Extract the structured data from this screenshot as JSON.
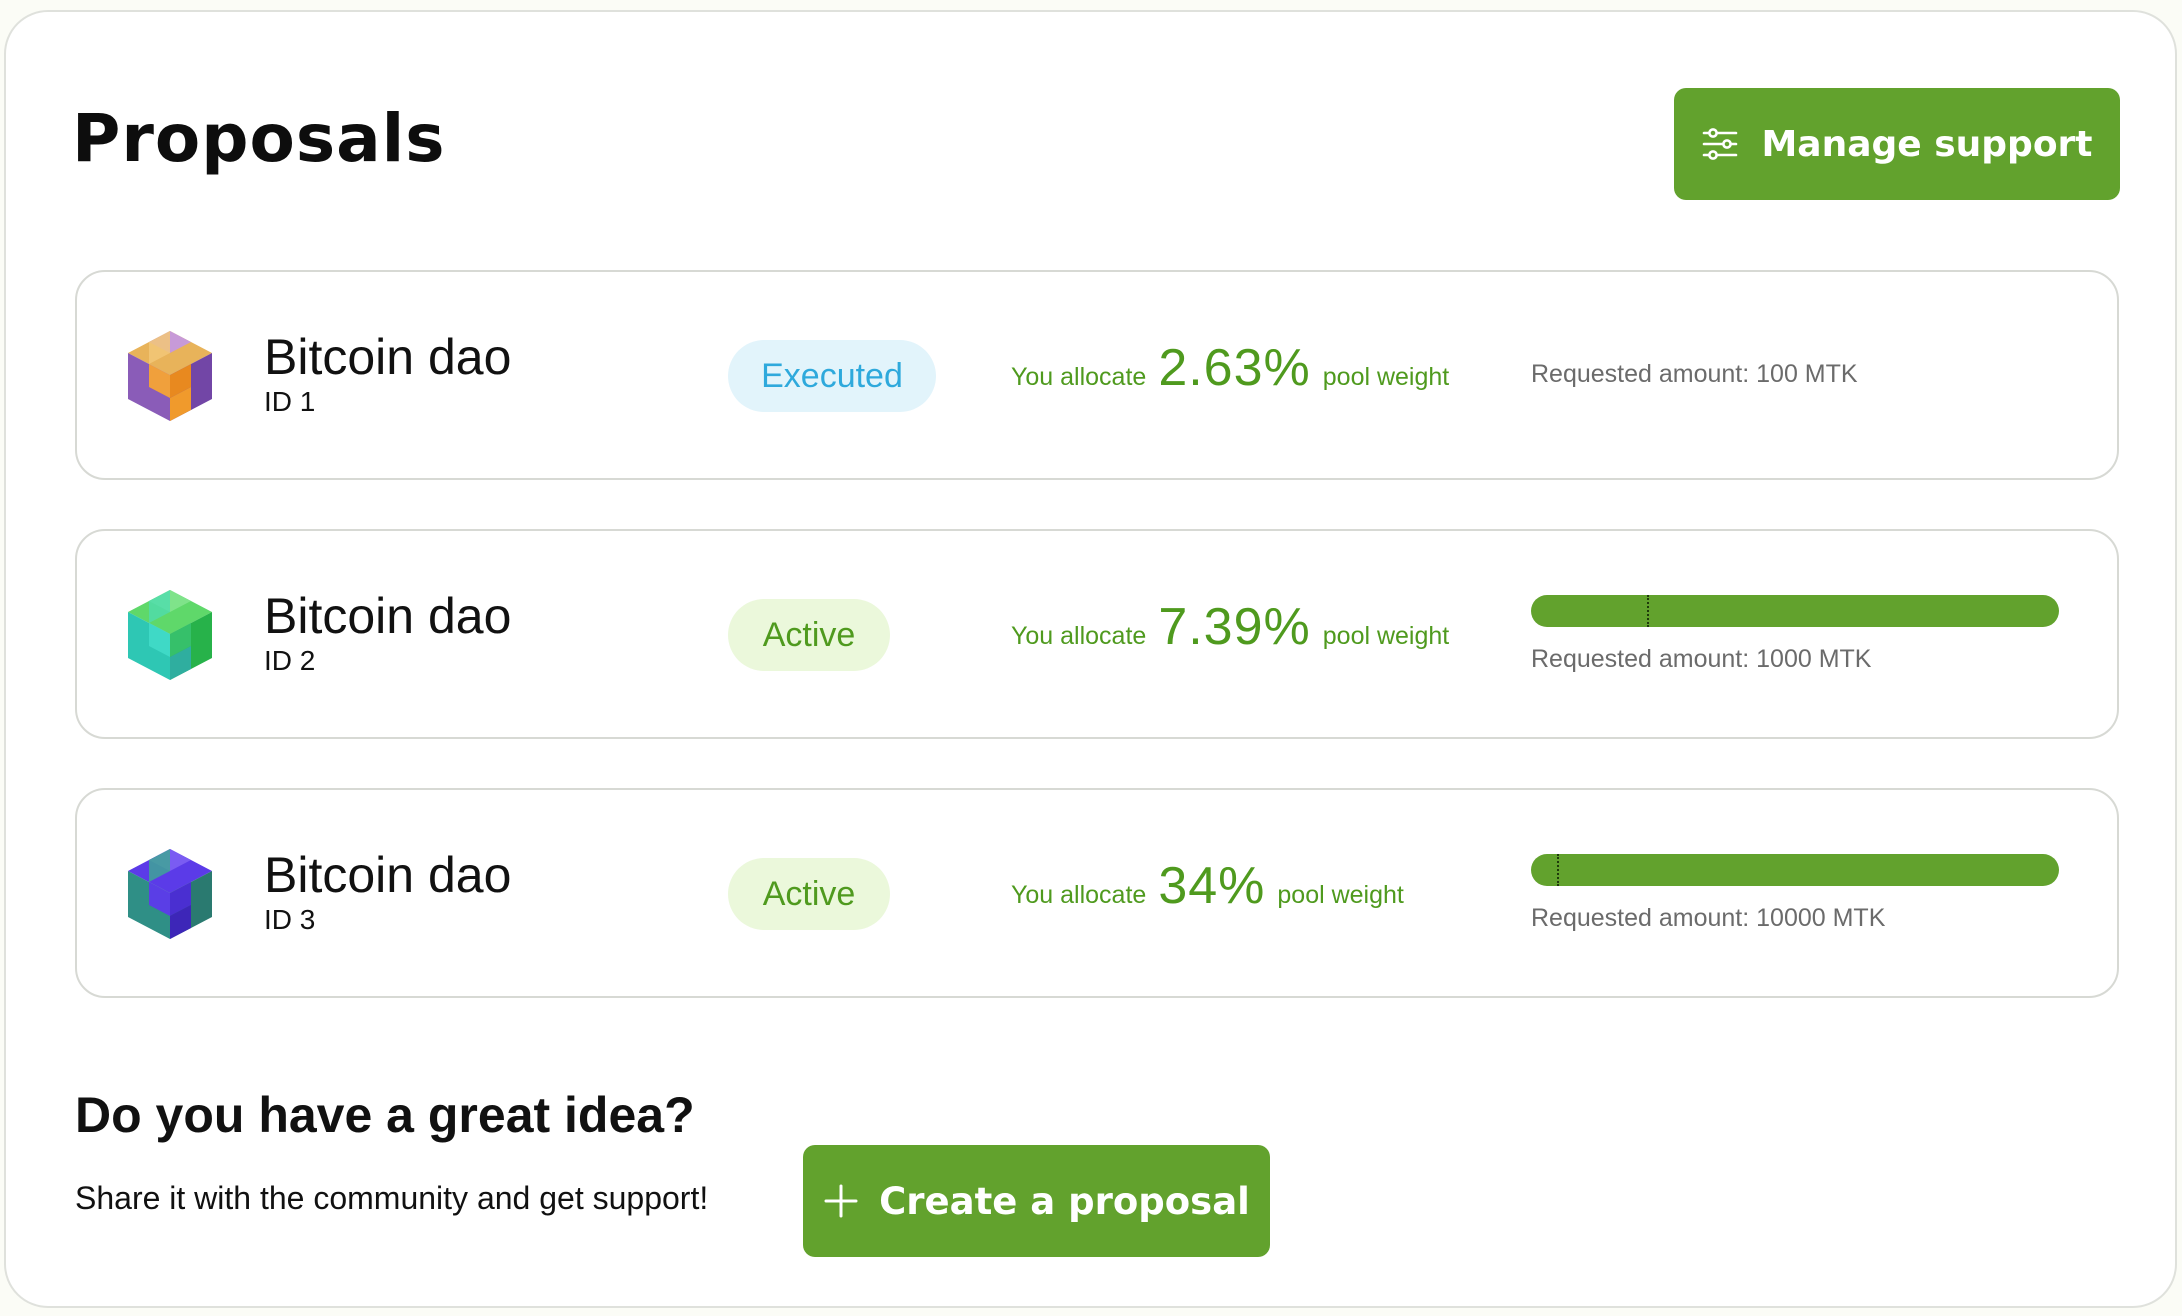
{
  "header": {
    "title": "Proposals",
    "manage_label": "Manage support",
    "manage_icon": "sliders-icon"
  },
  "colors": {
    "accent": "#62a22d",
    "executed_bg": "#e2f4fb",
    "executed_text": "#2ea9dc",
    "active_bg": "#ebf8db",
    "active_text": "#4f9a1e"
  },
  "proposals": [
    {
      "name": "Bitcoin dao",
      "id_label": "ID 1",
      "status": "Executed",
      "alloc_prefix": "You allocate",
      "alloc_pct": "2.63%",
      "alloc_suffix": "pool weight",
      "requested": "Requested amount: 100 MTK",
      "avatar_icon": "purple-orange-cube-icon"
    },
    {
      "name": "Bitcoin dao",
      "id_label": "ID 2",
      "status": "Active",
      "alloc_prefix": "You allocate",
      "alloc_pct": "7.39%",
      "alloc_suffix": "pool weight",
      "requested": "Requested amount: 1000 MTK",
      "progress_marker": 0.22,
      "avatar_icon": "teal-green-cube-icon"
    },
    {
      "name": "Bitcoin dao",
      "id_label": "ID 3",
      "status": "Active",
      "alloc_prefix": "You allocate",
      "alloc_pct": "34%",
      "alloc_suffix": "pool weight",
      "requested": "Requested amount: 10000 MTK",
      "progress_marker": 0.05,
      "avatar_icon": "blue-teal-cube-icon"
    }
  ],
  "cta": {
    "title": "Do you have a great idea?",
    "subtitle": "Share it with the community and get support!",
    "button_label": "Create a proposal",
    "button_icon": "plus-icon"
  }
}
